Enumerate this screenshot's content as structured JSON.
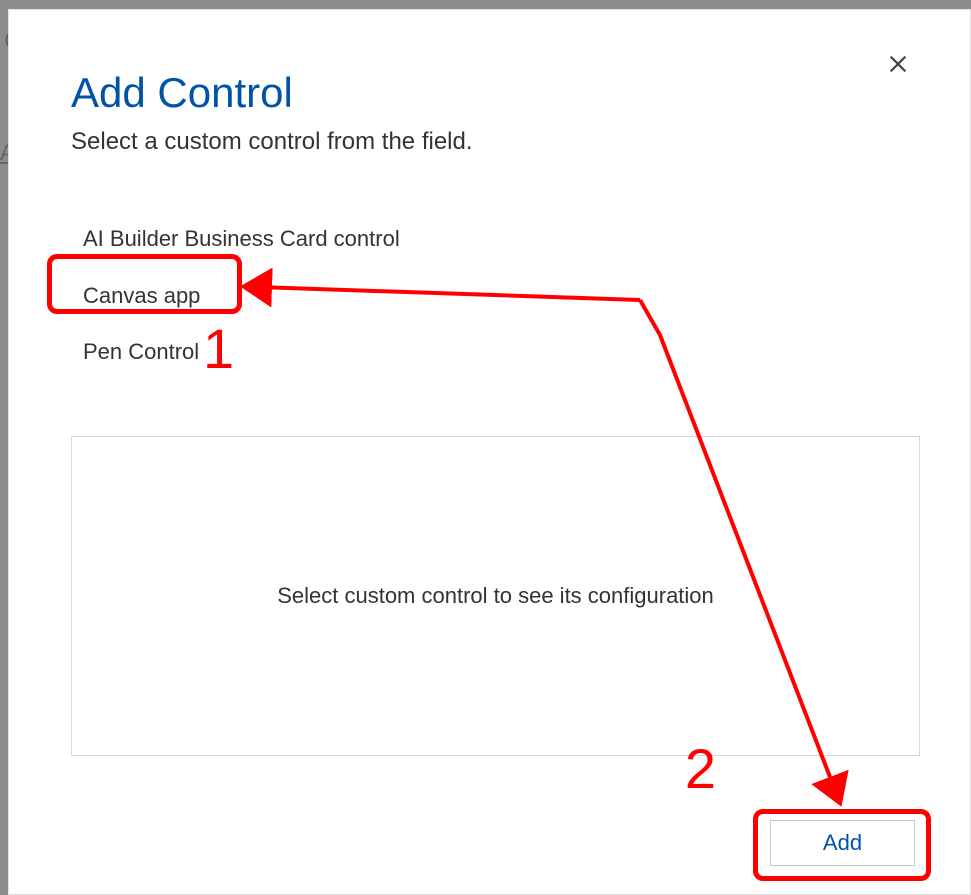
{
  "dialog": {
    "title": "Add Control",
    "subtitle": "Select a custom control from the field.",
    "close_label": "Close"
  },
  "controls": {
    "items": [
      {
        "label": "AI Builder Business Card control"
      },
      {
        "label": "Canvas app"
      },
      {
        "label": "Pen Control"
      }
    ]
  },
  "config": {
    "placeholder": "Select custom control to see its configuration"
  },
  "footer": {
    "add_label": "Add"
  },
  "annotations": {
    "step1": "1",
    "step2": "2"
  }
}
